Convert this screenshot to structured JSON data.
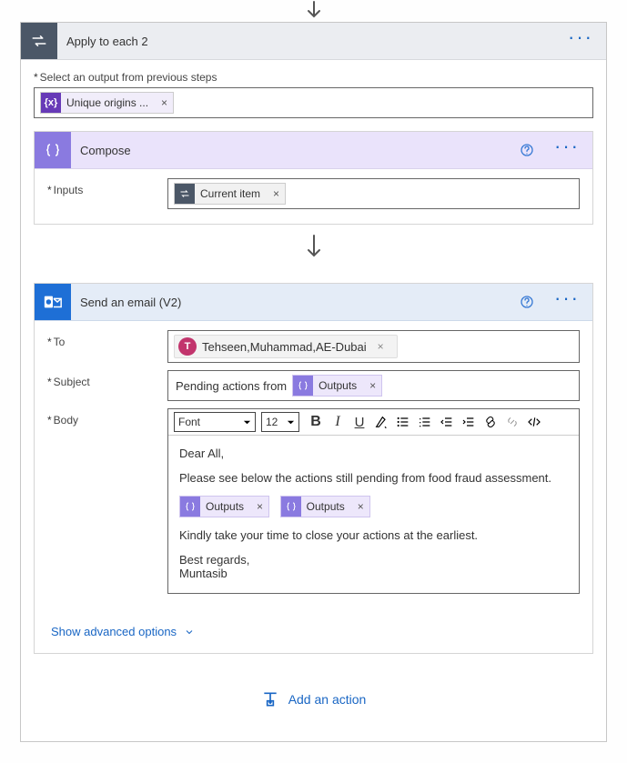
{
  "applyToEach": {
    "title": "Apply to each 2",
    "fieldLabel": "Select an output from previous steps",
    "token": {
      "label": "Unique origins ...",
      "iconName": "variable-icon"
    }
  },
  "compose": {
    "title": "Compose",
    "inputsLabel": "Inputs",
    "token": {
      "label": "Current item",
      "iconName": "loop-icon"
    }
  },
  "email": {
    "title": "Send an email (V2)",
    "toLabel": "To",
    "subjectLabel": "Subject",
    "bodyLabel": "Body",
    "to": {
      "avatar": "T",
      "name": "Tehseen,Muhammad,AE-Dubai"
    },
    "subjectPrefix": "Pending actions from",
    "subjectToken": "Outputs",
    "toolbar": {
      "font": "Font",
      "size": "12"
    },
    "body": {
      "line1": "Dear All,",
      "line2": "Please see below the actions still pending from food fraud assessment.",
      "token1": "Outputs",
      "token2": "Outputs",
      "line3": "Kindly take your time to close your actions at the earliest.",
      "line4a": "Best regards,",
      "line4b": "Muntasib"
    },
    "advancedLink": "Show advanced options"
  },
  "addAction": "Add an action"
}
